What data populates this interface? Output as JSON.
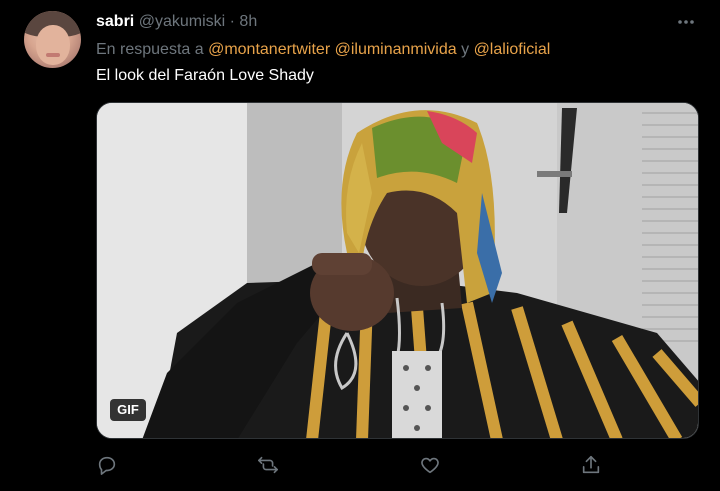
{
  "tweet": {
    "author_name": "sabri",
    "author_handle": "@yakumiski",
    "separator": "·",
    "time": "8h",
    "reply_prefix": "En respuesta a",
    "mention_1": "@montanertwiter",
    "mention_2": "@iluminanmivida",
    "mention_joiner": "y",
    "mention_3": "@lalioficial",
    "text": "El look del Faraón Love Shady",
    "media_badge": "GIF"
  },
  "icons": {
    "more": "more-horizontal-icon",
    "reply": "reply-icon",
    "retweet": "retweet-icon",
    "like": "like-icon",
    "share": "share-icon"
  },
  "colors": {
    "background": "#000000",
    "name": "#ffffff",
    "secondary_text": "#6e767d",
    "mention": "#e8a34a",
    "body_text": "#ffffff"
  }
}
